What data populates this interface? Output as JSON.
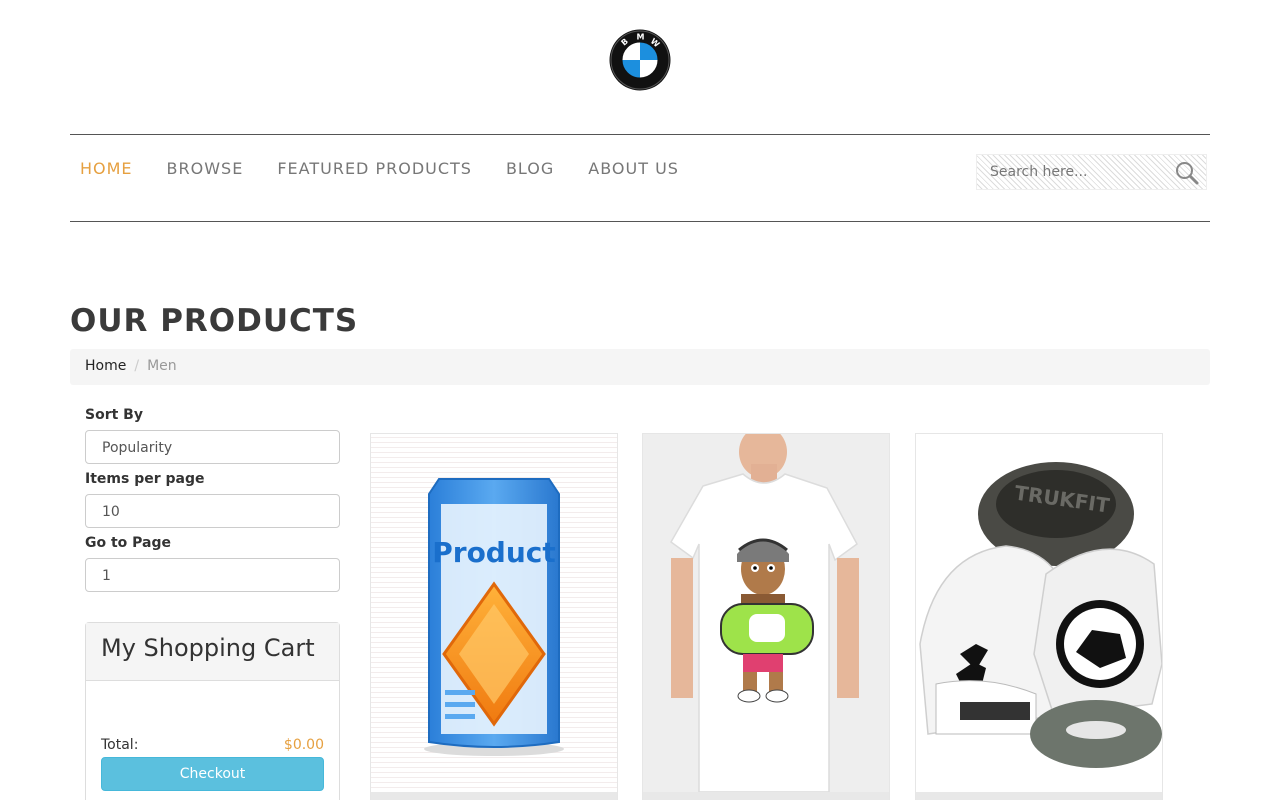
{
  "header": {
    "logo": {
      "letters": [
        "B",
        "M",
        "W"
      ],
      "colors": {
        "blue": "#1c8fde",
        "ring": "#111111"
      }
    }
  },
  "nav": {
    "items": [
      {
        "label": "HOME",
        "active": true
      },
      {
        "label": "BROWSE",
        "active": false
      },
      {
        "label": "FEATURED PRODUCTS",
        "active": false
      },
      {
        "label": "BLOG",
        "active": false
      },
      {
        "label": "ABOUT US",
        "active": false
      }
    ],
    "accent_color": "#e6a040"
  },
  "search": {
    "placeholder": "Search here...",
    "icon": "magnifier-icon"
  },
  "main": {
    "title": "OUR PRODUCTS",
    "breadcrumb": {
      "home": "Home",
      "separator": "/",
      "current": "Men"
    }
  },
  "filters": {
    "sort_by": {
      "label": "Sort By",
      "value": "Popularity"
    },
    "items_per_page": {
      "label": "Items per page",
      "value": "10"
    },
    "go_to_page": {
      "label": "Go to Page",
      "value": "1"
    }
  },
  "cart": {
    "title": "My Shopping Cart",
    "total_label": "Total:",
    "total_value": "$0.00",
    "checkout_label": "Checkout",
    "checkout_color": "#5bc0de"
  },
  "products": [
    {
      "image": "product-box-placeholder",
      "image_text": "Product"
    },
    {
      "image": "graphic-tshirt-photo"
    },
    {
      "image": "snapback-caps-photo",
      "image_text": "TRUKFIT"
    }
  ]
}
